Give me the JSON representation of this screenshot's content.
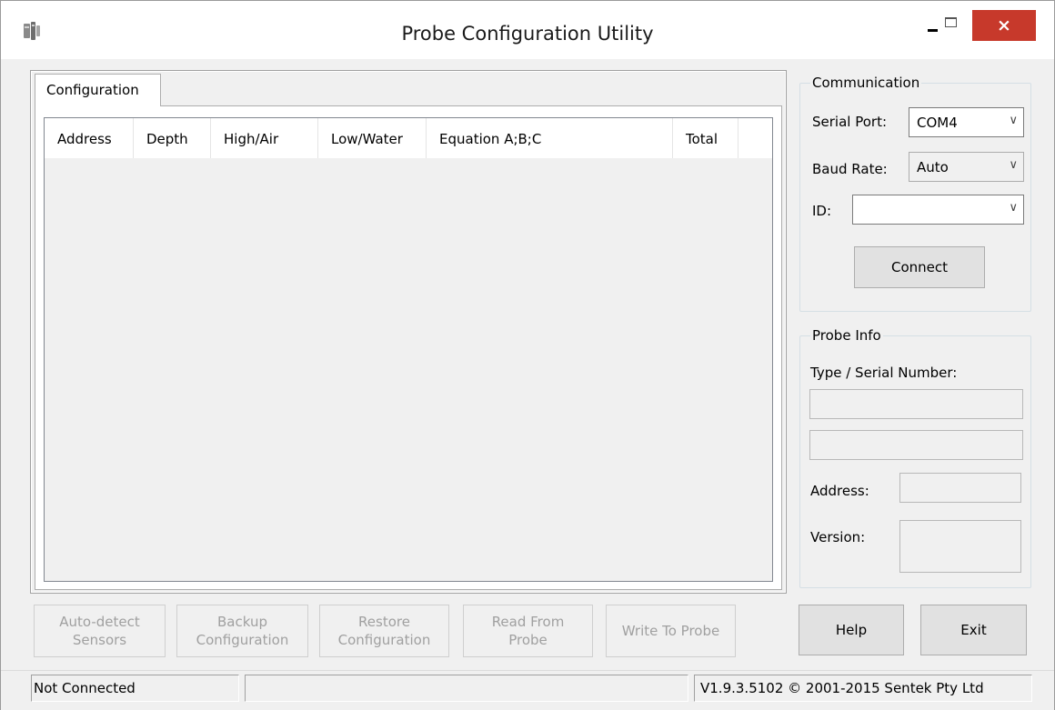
{
  "window": {
    "title": "Probe Configuration Utility",
    "close_glyph": "×"
  },
  "tabs": [
    {
      "label": "Configuration",
      "selected": true
    }
  ],
  "table": {
    "columns": [
      "Address",
      "Depth",
      "High/Air",
      "Low/Water",
      "Equation  A;B;C",
      "Total"
    ],
    "rows": []
  },
  "communication": {
    "title": "Communication",
    "serial_port_label": "Serial Port:",
    "serial_port_value": "COM4",
    "baud_rate_label": "Baud Rate:",
    "baud_rate_value": "Auto",
    "id_label": "ID:",
    "id_value": "",
    "connect_label": "Connect",
    "dropdown_glyph": "∨"
  },
  "probe_info": {
    "title": "Probe Info",
    "type_serial_label": "Type / Serial Number:",
    "address_label": "Address:",
    "version_label": "Version:"
  },
  "actions": {
    "auto_detect": "Auto-detect\nSensors",
    "backup": "Backup\nConfiguration",
    "restore": "Restore\nConfiguration",
    "read": "Read From\nProbe",
    "write": "Write To Probe",
    "help": "Help",
    "exit": "Exit"
  },
  "status": {
    "connection": "Not Connected",
    "middle": "",
    "version": "V1.9.3.5102 © 2001-2015 Sentek Pty Ltd"
  }
}
